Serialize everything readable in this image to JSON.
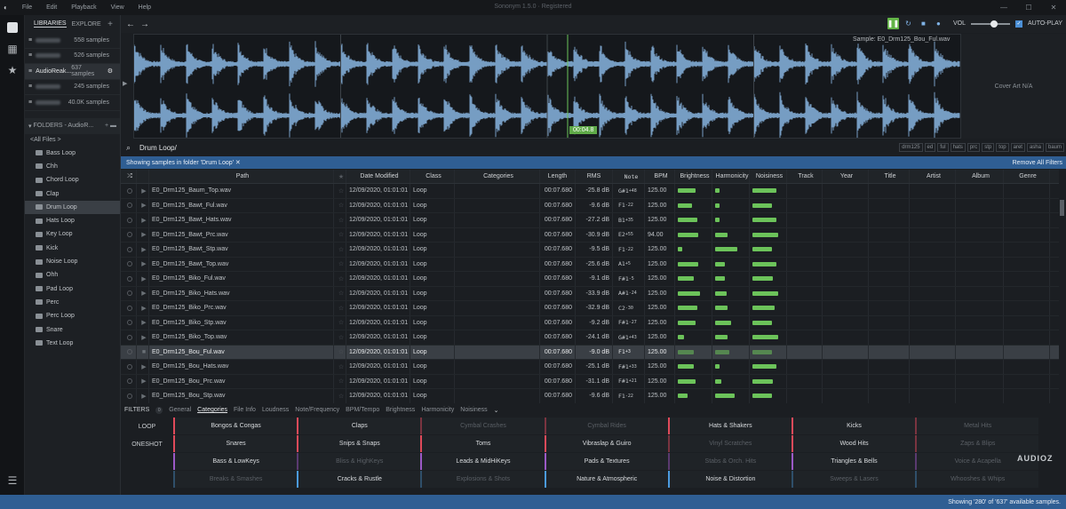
{
  "titlebar": {
    "menu": [
      "File",
      "Edit",
      "Playback",
      "View",
      "Help"
    ],
    "title": "Sononym 1.5.0 · Registered"
  },
  "sidebar": {
    "tabs": [
      "LIBRARIES",
      "EXPLORE"
    ],
    "libraries": [
      {
        "count": "558 samples"
      },
      {
        "count": "526 samples"
      },
      {
        "name": "AudioReak...",
        "count": "637 samples",
        "selected": true
      },
      {
        "count": "245 samples"
      },
      {
        "count": "40.0K samples"
      }
    ],
    "folders_header": "FOLDERS - AudioR...",
    "all_files": "<All Files >",
    "folders": [
      "Bass Loop",
      "Chh",
      "Chord Loop",
      "Clap",
      "Drum Loop",
      "Hats Loop",
      "Key Loop",
      "Kick",
      "Noise Loop",
      "Ohh",
      "Pad Loop",
      "Perc",
      "Perc Loop",
      "Snare",
      "Text Loop"
    ],
    "selected_folder": "Drum Loop"
  },
  "toolbar": {
    "vol_label": "VOL",
    "vol_level": 0.6,
    "autoplay_label": "AUTO-PLAY"
  },
  "waveform": {
    "filename": "Sample: E0_Drm125_Bou_Ful.wav",
    "time": "00:04.8",
    "cover_art": "Cover Art N/A"
  },
  "search": {
    "value": "Drum Loop/",
    "tags": [
      "drm125",
      "ed",
      "ful",
      "hats",
      "prc",
      "stp",
      "top",
      "aret",
      "asha",
      "baum"
    ]
  },
  "infobar": {
    "text": "Showing samples in folder 'Drum Loop' ✕",
    "remove_all": "Remove All Filters"
  },
  "table": {
    "headers": {
      "path": "Path",
      "star": "★",
      "date": "Date Modified",
      "class": "Class",
      "categories": "Categories",
      "length": "Length",
      "rms": "RMS",
      "note": "Note",
      "bpm": "BPM",
      "brightness": "Brightness",
      "harmonicity": "Harmonicity",
      "noisiness": "Noisiness",
      "track": "Track",
      "year": "Year",
      "title": "Title",
      "artist": "Artist",
      "album": "Album",
      "genre": "Genre"
    },
    "rows": [
      {
        "path": "E0_Drm125_Baum_Top.wav",
        "date": "12/09/2020, 01:01:01",
        "class": "Loop",
        "length": "00:07.680",
        "rms": "-25.8 dB",
        "note": "G#1",
        "cents": "+48",
        "bpm": "125.00",
        "bright": 0.55,
        "harm": 0.15,
        "noise": 0.75
      },
      {
        "path": "E0_Drm125_Bawt_Ful.wav",
        "date": "12/09/2020, 01:01:01",
        "class": "Loop",
        "length": "00:07.680",
        "rms": "-9.6 dB",
        "note": "F1",
        "cents": "-22",
        "bpm": "125.00",
        "bright": 0.45,
        "harm": 0.15,
        "noise": 0.6
      },
      {
        "path": "E0_Drm125_Bawt_Hats.wav",
        "date": "12/09/2020, 01:01:01",
        "class": "Loop",
        "length": "00:07.680",
        "rms": "-27.2 dB",
        "note": "B1",
        "cents": "+35",
        "bpm": "125.00",
        "bright": 0.6,
        "harm": 0.15,
        "noise": 0.75
      },
      {
        "path": "E0_Drm125_Bawt_Prc.wav",
        "date": "12/09/2020, 01:01:01",
        "class": "Loop",
        "length": "00:07.680",
        "rms": "-30.9 dB",
        "note": "E2",
        "cents": "+55",
        "bpm": "94.00",
        "bright": 0.65,
        "harm": 0.4,
        "noise": 0.8
      },
      {
        "path": "E0_Drm125_Bawt_Stp.wav",
        "date": "12/09/2020, 01:01:01",
        "class": "Loop",
        "length": "00:07.680",
        "rms": "-9.5 dB",
        "note": "F1",
        "cents": "-22",
        "bpm": "125.00",
        "bright": 0.15,
        "harm": 0.7,
        "noise": 0.6
      },
      {
        "path": "E0_Drm125_Bawt_Top.wav",
        "date": "12/09/2020, 01:01:01",
        "class": "Loop",
        "length": "00:07.680",
        "rms": "-25.6 dB",
        "note": "A1",
        "cents": "+5",
        "bpm": "125.00",
        "bright": 0.65,
        "harm": 0.3,
        "noise": 0.75
      },
      {
        "path": "E0_Drm125_Biko_Ful.wav",
        "date": "12/09/2020, 01:01:01",
        "class": "Loop",
        "length": "00:07.680",
        "rms": "-9.1 dB",
        "note": "F#1",
        "cents": "-5",
        "bpm": "125.00",
        "bright": 0.5,
        "harm": 0.3,
        "noise": 0.65
      },
      {
        "path": "E0_Drm125_Biko_Hats.wav",
        "date": "12/09/2020, 01:01:01",
        "class": "Loop",
        "length": "00:07.680",
        "rms": "-33.9 dB",
        "note": "A#1",
        "cents": "-24",
        "bpm": "125.00",
        "bright": 0.7,
        "harm": 0.35,
        "noise": 0.8
      },
      {
        "path": "E0_Drm125_Biko_Prc.wav",
        "date": "12/09/2020, 01:01:01",
        "class": "Loop",
        "length": "00:07.680",
        "rms": "-32.9 dB",
        "note": "C2",
        "cents": "-30",
        "bpm": "125.00",
        "bright": 0.6,
        "harm": 0.4,
        "noise": 0.7
      },
      {
        "path": "E0_Drm125_Biko_Stp.wav",
        "date": "12/09/2020, 01:01:01",
        "class": "Loop",
        "length": "00:07.680",
        "rms": "-9.2 dB",
        "note": "F#1",
        "cents": "-27",
        "bpm": "125.00",
        "bright": 0.55,
        "harm": 0.5,
        "noise": 0.6
      },
      {
        "path": "E0_Drm125_Biko_Top.wav",
        "date": "12/09/2020, 01:01:01",
        "class": "Loop",
        "length": "00:07.680",
        "rms": "-24.1 dB",
        "note": "G#1",
        "cents": "+43",
        "bpm": "125.00",
        "bright": 0.2,
        "harm": 0.4,
        "noise": 0.8
      },
      {
        "path": "E0_Drm125_Bou_Ful.wav",
        "date": "12/09/2020, 01:01:01",
        "class": "Loop",
        "length": "00:07.680",
        "rms": "-9.0 dB",
        "note": "F1",
        "cents": "+3",
        "bpm": "125.00",
        "bright": 0.5,
        "harm": 0.45,
        "noise": 0.6,
        "selected": true
      },
      {
        "path": "E0_Drm125_Bou_Hats.wav",
        "date": "12/09/2020, 01:01:01",
        "class": "Loop",
        "length": "00:07.680",
        "rms": "-25.1 dB",
        "note": "F#1",
        "cents": "+33",
        "bpm": "125.00",
        "bright": 0.5,
        "harm": 0.15,
        "noise": 0.75
      },
      {
        "path": "E0_Drm125_Bou_Prc.wav",
        "date": "12/09/2020, 01:01:01",
        "class": "Loop",
        "length": "00:07.680",
        "rms": "-31.1 dB",
        "note": "F#1",
        "cents": "+21",
        "bpm": "125.00",
        "bright": 0.55,
        "harm": 0.2,
        "noise": 0.65
      },
      {
        "path": "E0_Drm125_Bou_Stp.wav",
        "date": "12/09/2020, 01:01:01",
        "class": "Loop",
        "length": "00:07.680",
        "rms": "-9.6 dB",
        "note": "F1",
        "cents": "-22",
        "bpm": "125.00",
        "bright": 0.3,
        "harm": 0.6,
        "noise": 0.6
      }
    ]
  },
  "filters": {
    "label": "FILTERS",
    "count": "0",
    "tabs": [
      "General",
      "Categories",
      "File Info",
      "Loudness",
      "Note/Frequency",
      "BPM/Tempo",
      "Brightness",
      "Harmonicity",
      "Noisiness"
    ],
    "active_tab": "Categories",
    "row_labels": [
      "LOOP",
      "ONESHOT",
      "",
      ""
    ],
    "grid": [
      [
        {
          "t": "Bongos & Congas",
          "c": "#e04a5a",
          "d": false
        },
        {
          "t": "Claps",
          "c": "#e04a5a",
          "d": false
        },
        {
          "t": "Cymbal Crashes",
          "c": "#7a3440",
          "d": true
        },
        {
          "t": "Cymbal Rides",
          "c": "#7a3440",
          "d": true
        },
        {
          "t": "Hats & Shakers",
          "c": "#e04a5a",
          "d": false
        },
        {
          "t": "Kicks",
          "c": "#e04a5a",
          "d": false
        },
        {
          "t": "Metal Hits",
          "c": "#7a3440",
          "d": true
        }
      ],
      [
        {
          "t": "Snares",
          "c": "#e04a5a",
          "d": false
        },
        {
          "t": "Snips & Snaps",
          "c": "#e04a5a",
          "d": false
        },
        {
          "t": "Toms",
          "c": "#e04a5a",
          "d": false
        },
        {
          "t": "Vibraslap & Guiro",
          "c": "#e04a5a",
          "d": false
        },
        {
          "t": "Vinyl Scratches",
          "c": "#7a3440",
          "d": true
        },
        {
          "t": "Wood Hits",
          "c": "#e04a5a",
          "d": false
        },
        {
          "t": "Zaps & Blips",
          "c": "#7a3440",
          "d": true
        }
      ],
      [
        {
          "t": "Bass & LowKeys",
          "c": "#9b59c6",
          "d": false
        },
        {
          "t": "Bliss & HighKeys",
          "c": "#5a3a70",
          "d": true
        },
        {
          "t": "Leads & MidHiKeys",
          "c": "#9b59c6",
          "d": false
        },
        {
          "t": "Pads & Textures",
          "c": "#9b59c6",
          "d": false
        },
        {
          "t": "Stabs & Orch. Hits",
          "c": "#5a3a70",
          "d": true
        },
        {
          "t": "Triangles & Bells",
          "c": "#9b59c6",
          "d": false
        },
        {
          "t": "Voice & Acapella",
          "c": "#5a3a70",
          "d": true
        }
      ],
      [
        {
          "t": "Breaks & Smashes",
          "c": "#2f4f6a",
          "d": true
        },
        {
          "t": "Cracks & Rustle",
          "c": "#4b9be0",
          "d": false
        },
        {
          "t": "Explosions & Shots",
          "c": "#2f4f6a",
          "d": true
        },
        {
          "t": "Nature & Atmospheric",
          "c": "#4b9be0",
          "d": false
        },
        {
          "t": "Noise & Distortion",
          "c": "#4b9be0",
          "d": false
        },
        {
          "t": "Sweeps & Lasers",
          "c": "#2f4f6a",
          "d": true
        },
        {
          "t": "Whooshes & Whips",
          "c": "#2f4f6a",
          "d": true
        }
      ]
    ]
  },
  "status": {
    "text": "Showing '280' of '637' available samples.",
    "watermark": "AUDIOZ"
  },
  "colors": {
    "accent": "#2f5e93",
    "play_green": "#63b547",
    "bar_green": "#6cc35a",
    "wave_blue": "#8fc0ee"
  }
}
